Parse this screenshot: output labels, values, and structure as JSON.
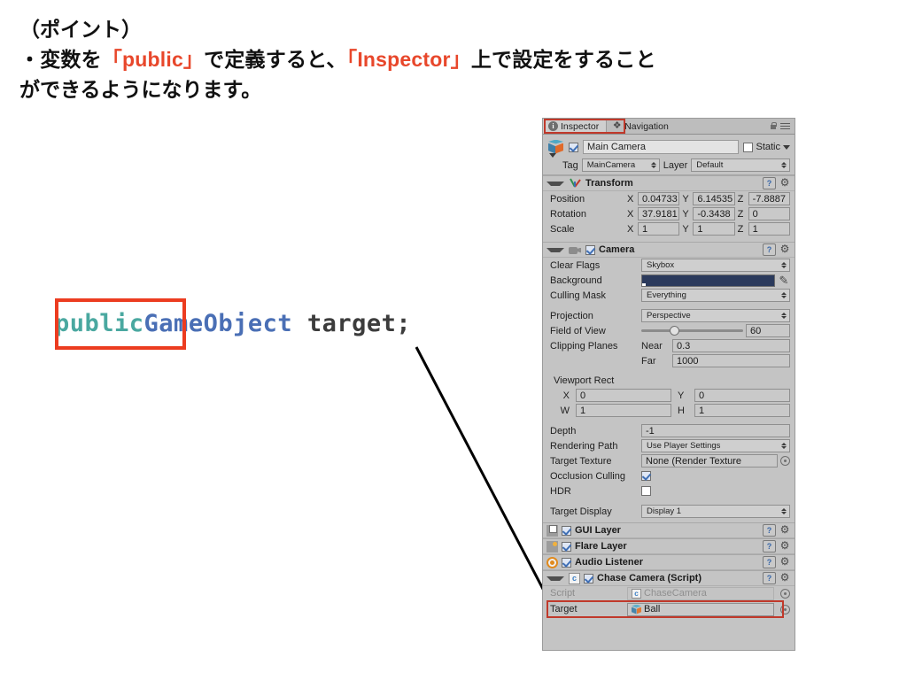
{
  "slide": {
    "heading_lines": [
      {
        "segments": [
          {
            "text": "（ポイント）",
            "color": "#111111"
          }
        ]
      },
      {
        "segments": [
          {
            "text": "・変数を",
            "color": "#111111"
          },
          {
            "text": "「public」",
            "color": "#e8472b"
          },
          {
            "text": "で定義すると、",
            "color": "#111111"
          },
          {
            "text": "「Inspector」",
            "color": "#e8472b"
          },
          {
            "text": "上で設定をすること",
            "color": "#111111"
          }
        ]
      },
      {
        "segments": [
          {
            "text": "ができるようになります。",
            "color": "#111111"
          }
        ]
      }
    ],
    "code": {
      "keyword": "public",
      "type": "GameObject",
      "variable": " target;",
      "keyword_color": "#4aa8a0",
      "type_color": "#4a6fb5",
      "variable_color": "#3c3c3c",
      "highlight_color": "#ec3c20"
    },
    "accent_color": "#e8472b",
    "highlight_color": "#c0392b"
  },
  "inspector": {
    "tabs": [
      {
        "label": "Inspector",
        "icon": "info-icon",
        "active": true,
        "highlighted": true
      },
      {
        "label": "Navigation",
        "icon": "navigation-icon",
        "active": false,
        "highlighted": false
      }
    ],
    "toolbar_icons": [
      "lock-icon",
      "menu-icon"
    ],
    "object": {
      "name": "Main Camera",
      "enabled": true,
      "static_label": "Static",
      "static_checked": false,
      "tag_label": "Tag",
      "tag_value": "MainCamera",
      "layer_label": "Layer",
      "layer_value": "Default"
    },
    "transform": {
      "title": "Transform",
      "rows": [
        {
          "label": "Position",
          "x": "0.04733",
          "y": "6.14535",
          "z": "-7.8887"
        },
        {
          "label": "Rotation",
          "x": "37.9181",
          "y": "-0.3438",
          "z": "0"
        },
        {
          "label": "Scale",
          "x": "1",
          "y": "1",
          "z": "1"
        }
      ],
      "axes": [
        "X",
        "Y",
        "Z"
      ]
    },
    "camera": {
      "title": "Camera",
      "enabled": true,
      "clear_flags_label": "Clear Flags",
      "clear_flags_value": "Skybox",
      "background_label": "Background",
      "background_color": "#2b3a5c",
      "culling_mask_label": "Culling Mask",
      "culling_mask_value": "Everything",
      "projection_label": "Projection",
      "projection_value": "Perspective",
      "fov_label": "Field of View",
      "fov_value": "60",
      "clipping_label": "Clipping Planes",
      "near_label": "Near",
      "near_value": "0.3",
      "far_label": "Far",
      "far_value": "1000",
      "viewport_label": "Viewport Rect",
      "viewport": {
        "x_label": "X",
        "x": "0",
        "y_label": "Y",
        "y": "0",
        "w_label": "W",
        "w": "1",
        "h_label": "H",
        "h": "1"
      },
      "depth_label": "Depth",
      "depth_value": "-1",
      "rendering_path_label": "Rendering Path",
      "rendering_path_value": "Use Player Settings",
      "target_texture_label": "Target Texture",
      "target_texture_value": "None (Render Texture",
      "occlusion_label": "Occlusion Culling",
      "occlusion_checked": true,
      "hdr_label": "HDR",
      "hdr_checked": false,
      "target_display_label": "Target Display",
      "target_display_value": "Display 1"
    },
    "components": [
      {
        "title": "GUI Layer",
        "enabled": true,
        "icon": "gui-layer-icon"
      },
      {
        "title": "Flare Layer",
        "enabled": true,
        "icon": "flare-layer-icon"
      },
      {
        "title": "Audio Listener",
        "enabled": true,
        "icon": "audio-listener-icon"
      }
    ],
    "script_component": {
      "title": "Chase Camera (Script)",
      "enabled": true,
      "icon": "script-icon",
      "script_label": "Script",
      "script_value": "ChaseCamera",
      "target_label": "Target",
      "target_value": "Ball",
      "target_highlighted": true
    }
  }
}
